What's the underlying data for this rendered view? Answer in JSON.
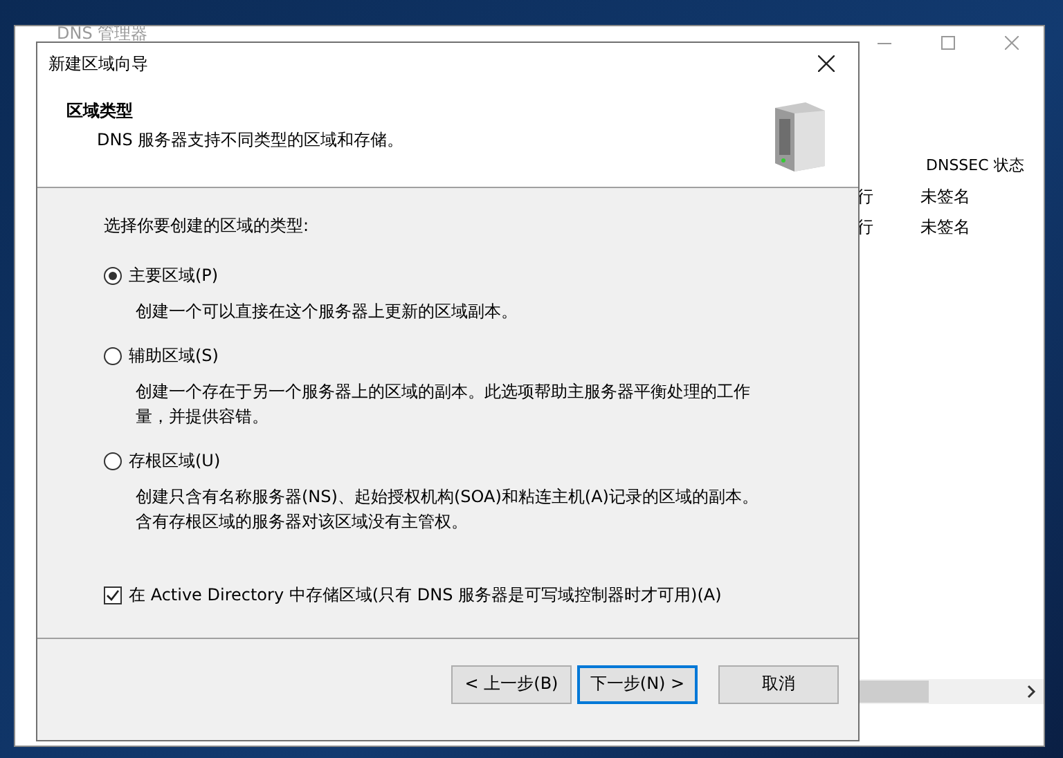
{
  "background_window": {
    "title": "DNS 管理器",
    "columns": [
      "DNSSEC 状态"
    ],
    "rows": [
      {
        "status": "行",
        "dnssec": "未签名"
      },
      {
        "status": "行",
        "dnssec": "未签名"
      }
    ]
  },
  "dialog": {
    "title": "新建区域向导",
    "header": {
      "title": "区域类型",
      "subtitle": "DNS 服务器支持不同类型的区域和存储。"
    },
    "prompt": "选择你要创建的区域的类型:",
    "options": [
      {
        "label": "主要区域(P)",
        "selected": true,
        "description": "创建一个可以直接在这个服务器上更新的区域副本。"
      },
      {
        "label": "辅助区域(S)",
        "selected": false,
        "description": "创建一个存在于另一个服务器上的区域的副本。此选项帮助主服务器平衡处理的工作量，并提供容错。"
      },
      {
        "label": "存根区域(U)",
        "selected": false,
        "description": "创建只含有名称服务器(NS)、起始授权机构(SOA)和粘连主机(A)记录的区域的副本。含有存根区域的服务器对该区域没有主管权。"
      }
    ],
    "ad_option": {
      "label": "在 Active Directory 中存储区域(只有 DNS 服务器是可写域控制器时才可用)(A)",
      "checked": true
    },
    "buttons": [
      {
        "label": "< 上一步(B)",
        "focused": false
      },
      {
        "label": "下一步(N) >",
        "focused": true
      },
      {
        "label": "取消",
        "focused": false
      }
    ]
  }
}
